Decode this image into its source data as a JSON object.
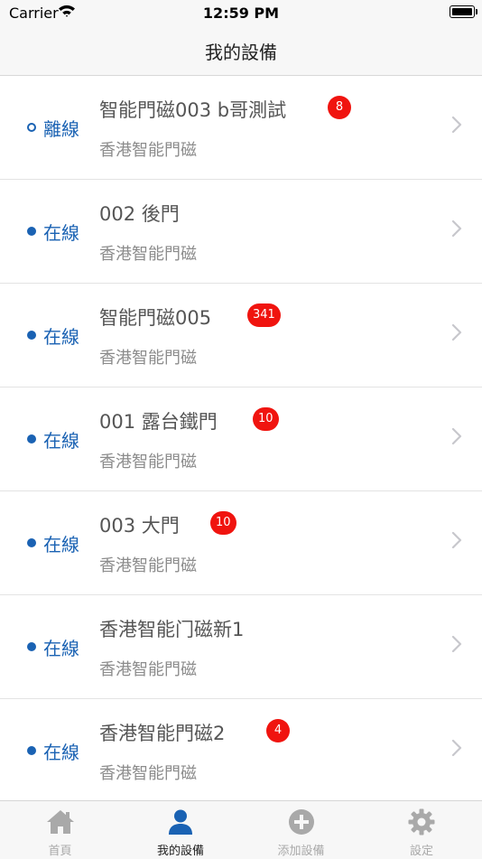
{
  "status_bar": {
    "carrier": "Carrier",
    "time": "12:59 PM"
  },
  "nav": {
    "title": "我的設備"
  },
  "devices": [
    {
      "name": "智能門磁003 b哥測試",
      "type": "香港智能門磁",
      "status": "離線",
      "online": false,
      "badge": "8"
    },
    {
      "name": "002 後門",
      "type": "香港智能門磁",
      "status": "在線",
      "online": true,
      "badge": ""
    },
    {
      "name": "智能門磁005",
      "type": "香港智能門磁",
      "status": "在線",
      "online": true,
      "badge": "341"
    },
    {
      "name": "001 露台鐵門",
      "type": "香港智能門磁",
      "status": "在線",
      "online": true,
      "badge": "10"
    },
    {
      "name": "003 大門",
      "type": "香港智能門磁",
      "status": "在線",
      "online": true,
      "badge": "10"
    },
    {
      "name": "香港智能门磁新1",
      "type": "香港智能門磁",
      "status": "在線",
      "online": true,
      "badge": ""
    },
    {
      "name": "香港智能門磁2",
      "type": "香港智能門磁",
      "status": "在線",
      "online": true,
      "badge": "4"
    }
  ],
  "tabs": [
    {
      "label": "首頁",
      "icon": "home-icon",
      "active": false
    },
    {
      "label": "我的設備",
      "icon": "person-icon",
      "active": true
    },
    {
      "label": "添加設備",
      "icon": "add-circle-icon",
      "active": false
    },
    {
      "label": "設定",
      "icon": "gear-icon",
      "active": false
    }
  ],
  "colors": {
    "accent": "#1a62b3",
    "badge": "#f0140f",
    "tab_active": "#1a62b3",
    "tab_inactive": "#a9a9a9"
  }
}
